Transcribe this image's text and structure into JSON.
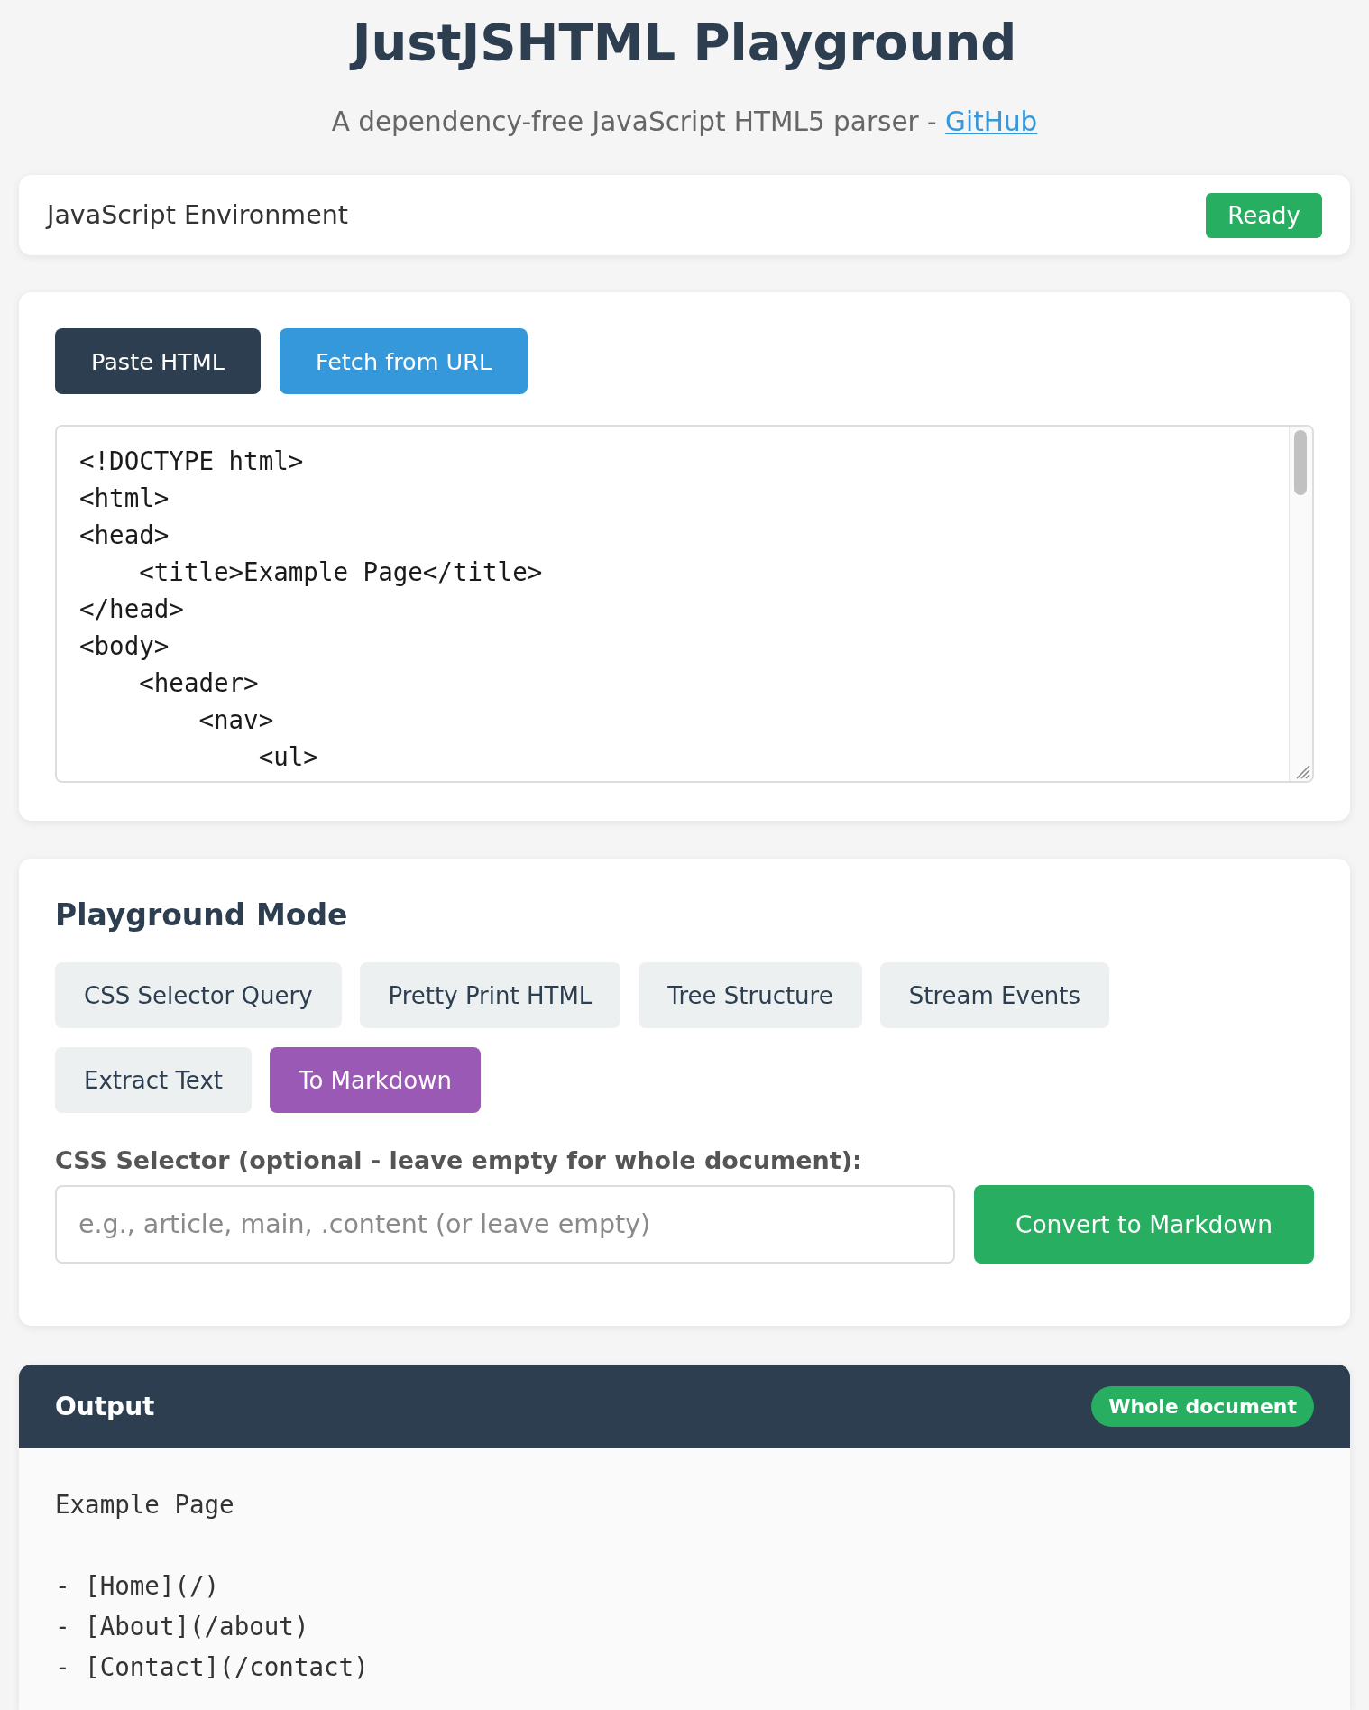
{
  "title": "JustJSHTML Playground",
  "subtitle": {
    "text": "A dependency-free JavaScript HTML5 parser -",
    "link": "GitHub"
  },
  "status": {
    "label": "JavaScript Environment",
    "badge": "Ready"
  },
  "source_tabs": [
    {
      "label": "Paste HTML",
      "selected": true
    },
    {
      "label": "Fetch from URL",
      "selected": false
    }
  ],
  "html_input": {
    "lines": [
      "<!DOCTYPE html>",
      "<html>",
      "<head>",
      "    <title>Example Page</title>",
      "</head>",
      "<body>",
      "    <header>",
      "        <nav>",
      "            <ul>"
    ]
  },
  "playground": {
    "heading": "Playground Mode",
    "modes": [
      {
        "label": "CSS Selector Query",
        "selected": false
      },
      {
        "label": "Pretty Print HTML",
        "selected": false
      },
      {
        "label": "Tree Structure",
        "selected": false
      },
      {
        "label": "Stream Events",
        "selected": false
      },
      {
        "label": "Extract Text",
        "selected": false
      },
      {
        "label": "To Markdown",
        "selected": true
      }
    ],
    "selector_input": {
      "label": "CSS Selector (optional - leave empty for whole document):",
      "placeholder": "e.g., article, main, .content (or leave empty)"
    },
    "action": "Convert to Markdown"
  },
  "output": {
    "title": "Output",
    "badge": "Whole document",
    "blocks": [
      {
        "lines": [
          "Example Page"
        ]
      },
      {
        "lines": [
          "- [Home](/)",
          "- [About](/about)",
          "- [Contact](/contact)"
        ]
      }
    ]
  }
}
